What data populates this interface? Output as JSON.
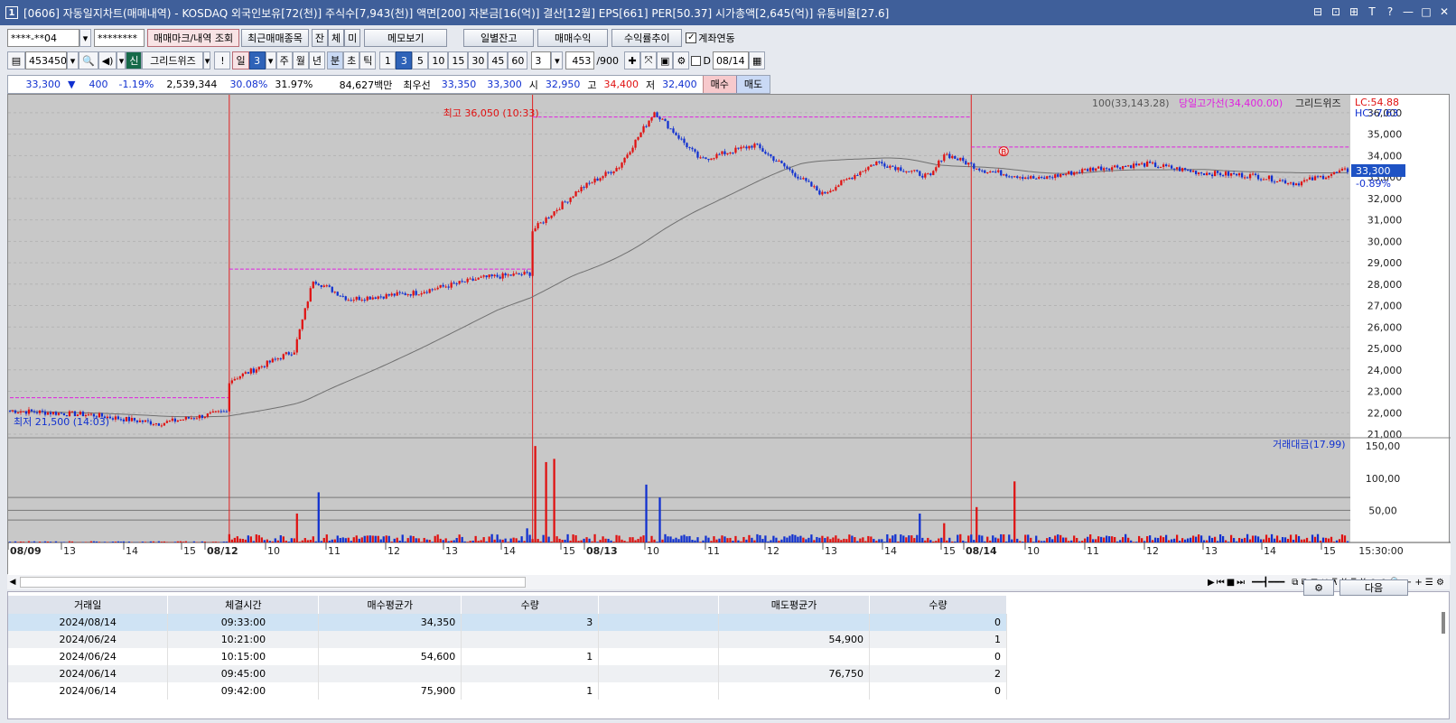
{
  "window": {
    "num": "1",
    "title": "[0606] 자동일지차트(매매내역) - KOSDAQ 외국인보유[72(천)] 주식수[7,943(천)] 액면[200] 자본금[16(억)] 결산[12월] EPS[661] PER[50.37] 시가총액[2,645(억)] 유통비율[27.6]",
    "controls": [
      "⊟",
      "⊡",
      "⊞",
      "T",
      "?",
      "—",
      "□",
      "✕"
    ]
  },
  "toolbar1": {
    "account": "****-**04",
    "password": "********",
    "btn_marks": "매매마크/내역 조회",
    "btn_recent": "최근매매종목",
    "b_jan": "잔",
    "b_che": "체",
    "b_mi": "미",
    "btn_memo": "메모보기",
    "btn_daily": "일별잔고",
    "btn_profit": "매매수익",
    "btn_trend": "수익률추이",
    "chk_label": "계좌연동"
  },
  "toolbar2": {
    "code": "453450",
    "sin": "신",
    "grid_wiz": "그리드위즈",
    "excl": "!",
    "day": "일",
    "day_num": "3",
    "week": "주",
    "month": "월",
    "year": "년",
    "minute": "분",
    "second": "초",
    "tick": "틱",
    "intervals": [
      "1",
      "3",
      "5",
      "10",
      "15",
      "30",
      "45",
      "60"
    ],
    "count_sel": "3",
    "count_val": "453",
    "count_total": "/900",
    "d_label": "D",
    "date": "08/14"
  },
  "quote": {
    "price": "33,300",
    "arrow": "▼",
    "change": "400",
    "rate": "-1.19%",
    "volume": "2,539,344",
    "r1": "30.08%",
    "r2": "31.97%",
    "amount": "84,627백만",
    "best_label": "최우선",
    "best_ask": "33,350",
    "best_bid": "33,300",
    "open_label": "시",
    "open": "32,950",
    "high_label": "고",
    "high": "34,400",
    "low_label": "저",
    "low": "32,400",
    "buy": "매수",
    "sell": "매도"
  },
  "chart_labels": {
    "ma_legend": "100(33,143.28)",
    "high_line_legend": "당일고가선(34,400.00)",
    "grid_wiz_legend": "그리드위즈",
    "lc": "LC:54.88",
    "hc": "HC:-7.63",
    "max_note": "최고 36,050 (10:33)",
    "min_note": "최저 21,500 (14:03)",
    "current_price": "33,300",
    "current_rate": "-0.89%",
    "vol_legend": "거래대금(17.99)",
    "b_marker": "B",
    "end_time": "15:30:00"
  },
  "colors": {
    "up": "#e01010",
    "down": "#1030d0",
    "ma": "#707070",
    "highline": "#e020e0",
    "vline": "#e02020",
    "price_box": "#1e52c4"
  },
  "chart_data": {
    "type": "candlestick",
    "price_axis": [
      "36,000",
      "35,000",
      "34,000",
      "33,000",
      "32,000",
      "31,000",
      "30,000",
      "29,000",
      "28,000",
      "27,000",
      "26,000",
      "25,000",
      "24,000",
      "23,000",
      "22,000",
      "21,000"
    ],
    "ylim": [
      21000,
      36500
    ],
    "vol_axis": [
      "150,00",
      "100,00",
      "50,00"
    ],
    "vol_ylim": [
      0,
      160
    ],
    "x_labels": [
      {
        "t": "08/09",
        "day": true
      },
      {
        "t": "13"
      },
      {
        "t": "14"
      },
      {
        "t": "15"
      },
      {
        "t": "08/12",
        "day": true
      },
      {
        "t": "10"
      },
      {
        "t": "11"
      },
      {
        "t": "12"
      },
      {
        "t": "13"
      },
      {
        "t": "14"
      },
      {
        "t": "15"
      },
      {
        "t": "08/13",
        "day": true
      },
      {
        "t": "10"
      },
      {
        "t": "11"
      },
      {
        "t": "12"
      },
      {
        "t": "13"
      },
      {
        "t": "14"
      },
      {
        "t": "15"
      },
      {
        "t": "08/14",
        "day": true
      },
      {
        "t": "10"
      },
      {
        "t": "11"
      },
      {
        "t": "12"
      },
      {
        "t": "13"
      },
      {
        "t": "14"
      },
      {
        "t": "15"
      }
    ],
    "day_high_lines": [
      22700,
      28700,
      35800,
      34400
    ],
    "key_points": [
      {
        "t": 0,
        "p": 22100
      },
      {
        "t": 30,
        "p": 21900
      },
      {
        "t": 55,
        "p": 21500
      },
      {
        "t": 80,
        "p": 22050
      },
      {
        "t": 81,
        "p": 23500
      },
      {
        "t": 90,
        "p": 24000
      },
      {
        "t": 105,
        "p": 24900
      },
      {
        "t": 112,
        "p": 28200
      },
      {
        "t": 125,
        "p": 27300
      },
      {
        "t": 150,
        "p": 27600
      },
      {
        "t": 175,
        "p": 28300
      },
      {
        "t": 192,
        "p": 28500
      },
      {
        "t": 193,
        "p": 30500
      },
      {
        "t": 210,
        "p": 32400
      },
      {
        "t": 225,
        "p": 33500
      },
      {
        "t": 238,
        "p": 36050
      },
      {
        "t": 255,
        "p": 33800
      },
      {
        "t": 275,
        "p": 34500
      },
      {
        "t": 300,
        "p": 32200
      },
      {
        "t": 320,
        "p": 33700
      },
      {
        "t": 340,
        "p": 33000
      },
      {
        "t": 345,
        "p": 34100
      },
      {
        "t": 360,
        "p": 33300
      },
      {
        "t": 380,
        "p": 32900
      },
      {
        "t": 400,
        "p": 33400
      },
      {
        "t": 420,
        "p": 33600
      },
      {
        "t": 440,
        "p": 33200
      },
      {
        "t": 460,
        "p": 33050
      },
      {
        "t": 475,
        "p": 32700
      },
      {
        "t": 493,
        "p": 33300
      }
    ],
    "vol_spikes": [
      {
        "t": 106,
        "v": 45
      },
      {
        "t": 114,
        "v": 78
      },
      {
        "t": 191,
        "v": 22
      },
      {
        "t": 194,
        "v": 150
      },
      {
        "t": 198,
        "v": 125
      },
      {
        "t": 201,
        "v": 130
      },
      {
        "t": 235,
        "v": 90
      },
      {
        "t": 240,
        "v": 70
      },
      {
        "t": 336,
        "v": 45
      },
      {
        "t": 345,
        "v": 30
      },
      {
        "t": 357,
        "v": 55
      },
      {
        "t": 371,
        "v": 95
      }
    ]
  },
  "bottom": {
    "gear": "⚙",
    "next": "다음",
    "columns": [
      "거래일",
      "체결시간",
      "매수평균가",
      "수량",
      "",
      "매도평균가",
      "수량"
    ],
    "rows": [
      [
        "2024/08/14",
        "09:33:00",
        "34,350",
        "3",
        "",
        "",
        "0"
      ],
      [
        "2024/06/24",
        "10:21:00",
        "",
        "",
        "",
        "54,900",
        "1"
      ],
      [
        "2024/06/24",
        "10:15:00",
        "54,600",
        "1",
        "",
        "",
        "0"
      ],
      [
        "2024/06/14",
        "09:45:00",
        "",
        "",
        "",
        "76,750",
        "2"
      ],
      [
        "2024/06/14",
        "09:42:00",
        "75,900",
        "1",
        "",
        "",
        "0"
      ]
    ]
  }
}
